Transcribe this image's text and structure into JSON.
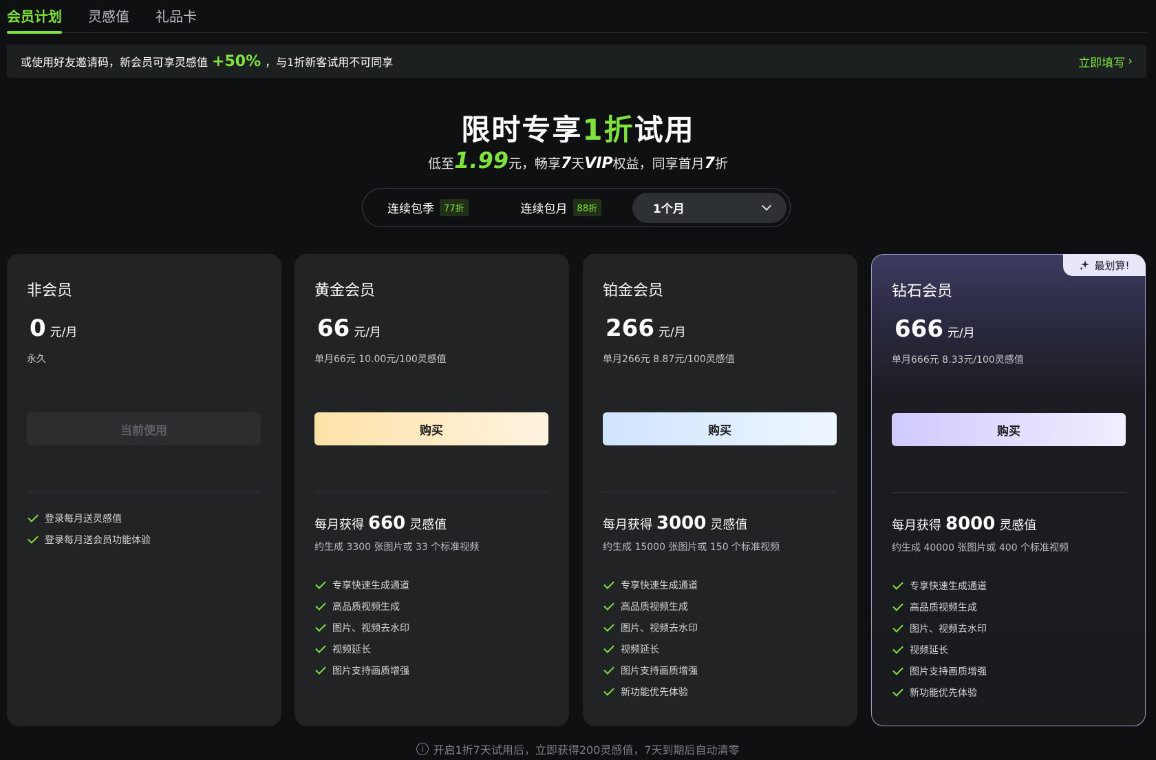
{
  "tabs": [
    {
      "label": "会员计划",
      "active": true
    },
    {
      "label": "灵感值",
      "active": false
    },
    {
      "label": "礼品卡",
      "active": false
    }
  ],
  "banner": {
    "text_before": "或使用好友邀请码，新会员可享灵感值",
    "percent": "+50%",
    "text_after": "，与1折新客试用不可同享",
    "link_label": "立即填写",
    "link_arrow": "›"
  },
  "hero": {
    "title_before": "限时专享",
    "title_highlight": "1折",
    "title_after": "试用",
    "sub_1": "低至",
    "sub_price": "1.99",
    "sub_2": "元，畅享",
    "sub_days": "7",
    "sub_3": "天",
    "sub_vip": "VIP",
    "sub_4": "权益，同享首月",
    "sub_disc": "7",
    "sub_5": "折"
  },
  "billing": {
    "options": [
      {
        "label": "连续包季",
        "badge": "77折"
      },
      {
        "label": "连续包月",
        "badge": "88折"
      }
    ],
    "dropdown_value": "1个月"
  },
  "plans": [
    {
      "name": "非会员",
      "price": "0",
      "unit": "元/月",
      "note": "永久",
      "button": "当前使用",
      "features": [
        "登录每月送灵感值",
        "登录每月送会员功能体验"
      ]
    },
    {
      "name": "黄金会员",
      "price": "66",
      "unit": "元/月",
      "note": "单月66元 10.00元/100灵感值",
      "button": "购买",
      "gain_prefix": "每月获得",
      "gain_num": "660",
      "gain_suffix": "灵感值",
      "gain_sub": "约生成 3300 张图片或 33 个标准视频",
      "features": [
        "专享快速生成通道",
        "高品质视频生成",
        "图片、视频去水印",
        "视频延长",
        "图片支持画质增强"
      ]
    },
    {
      "name": "铂金会员",
      "price": "266",
      "unit": "元/月",
      "note": "单月266元 8.87元/100灵感值",
      "button": "购买",
      "gain_prefix": "每月获得",
      "gain_num": "3000",
      "gain_suffix": "灵感值",
      "gain_sub": "约生成 15000 张图片或 150 个标准视频",
      "features": [
        "专享快速生成通道",
        "高品质视频生成",
        "图片、视频去水印",
        "视频延长",
        "图片支持画质增强",
        "新功能优先体验"
      ]
    },
    {
      "name": "钻石会员",
      "price": "666",
      "unit": "元/月",
      "note": "单月666元 8.33元/100灵感值",
      "button": "购买",
      "badge": "最划算!",
      "gain_prefix": "每月获得",
      "gain_num": "8000",
      "gain_suffix": "灵感值",
      "gain_sub": "约生成 40000 张图片或 400 个标准视频",
      "features": [
        "专享快速生成通道",
        "高品质视频生成",
        "图片、视频去水印",
        "视频延长",
        "图片支持画质增强",
        "新功能优先体验"
      ]
    }
  ],
  "footer": {
    "text": "开启1折7天试用后，立即获得200灵感值，7天到期后自动清零"
  },
  "colors": {
    "accent": "#7ee33f",
    "background": "#0e1011",
    "card": "#212324"
  }
}
